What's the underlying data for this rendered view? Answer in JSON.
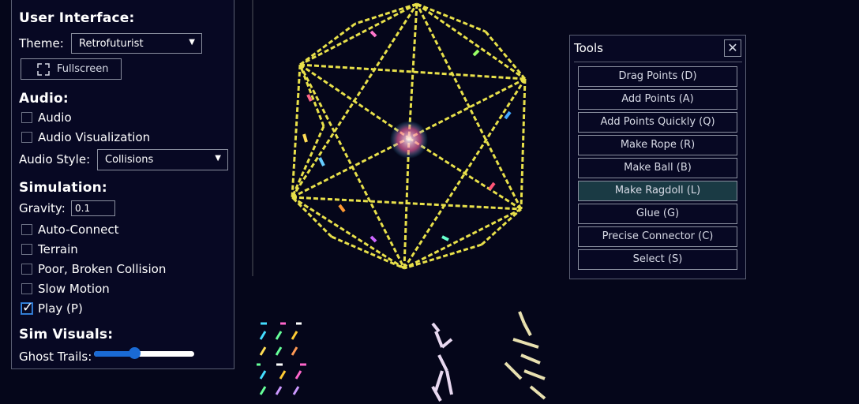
{
  "ui": {
    "user_interface_title": "User Interface:",
    "theme_label": "Theme:",
    "theme_value": "Retrofuturist",
    "fullscreen_label": "Fullscreen",
    "audio_title": "Audio:",
    "audio_label": "Audio",
    "audio_checked": false,
    "audio_vis_label": "Audio Visualization",
    "audio_vis_checked": false,
    "audio_style_label": "Audio Style:",
    "audio_style_value": "Collisions",
    "simulation_title": "Simulation:",
    "gravity_label": "Gravity:",
    "gravity_value": "0.1",
    "auto_connect_label": "Auto-Connect",
    "terrain_label": "Terrain",
    "poor_collision_label": "Poor, Broken Collision",
    "slow_motion_label": "Slow Motion",
    "play_label": "Play (P)",
    "play_checked": true,
    "sim_visuals_title": "Sim Visuals:",
    "ghost_trails_label": "Ghost Trails:",
    "ghost_trails_value": 0.4
  },
  "tools": {
    "title": "Tools",
    "close_glyph": "✕",
    "buttons": [
      {
        "label": "Drag Points (D)",
        "active": false
      },
      {
        "label": "Add Points (A)",
        "active": false
      },
      {
        "label": "Add Points Quickly (Q)",
        "active": false
      },
      {
        "label": "Make Rope (R)",
        "active": false
      },
      {
        "label": "Make Ball (B)",
        "active": false
      },
      {
        "label": "Make Ragdoll (L)",
        "active": true
      },
      {
        "label": "Glue (G)",
        "active": false
      },
      {
        "label": "Precise Connector (C)",
        "active": false
      },
      {
        "label": "Select (S)",
        "active": false
      }
    ]
  },
  "icons": {
    "fullscreen": "fullscreen-icon",
    "close": "close-icon",
    "dropdown": "chevron-down-icon"
  },
  "colors": {
    "background": "#05061a",
    "panel": "#070823",
    "accent": "#1a6ad4",
    "active_tool": "#1a3a44",
    "wireframe": "#e8e04a"
  }
}
